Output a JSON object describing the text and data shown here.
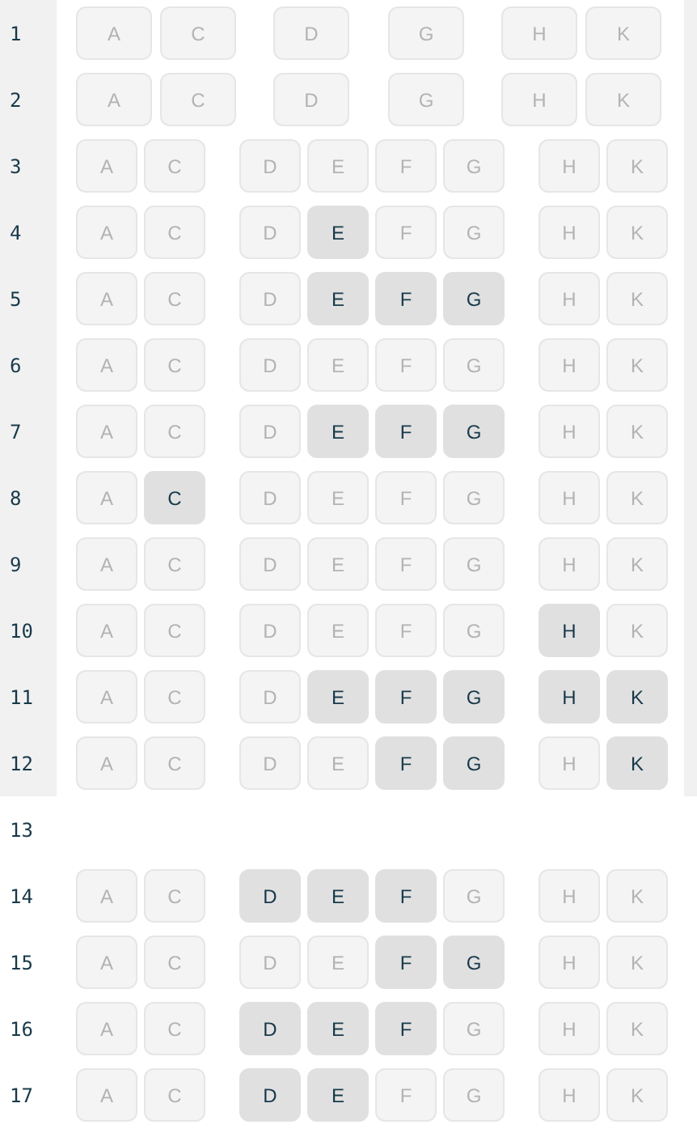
{
  "sections": [
    {
      "kind": "framed",
      "rows": [
        {
          "number": "1",
          "kind": "business",
          "blocks": [
            {
              "seats": [
                {
                  "letter": "A",
                  "available": false
                },
                {
                  "letter": "C",
                  "available": false
                }
              ]
            },
            {
              "seats": [
                {
                  "letter": "D",
                  "available": false
                },
                {
                  "letter": "G",
                  "available": false
                }
              ]
            },
            {
              "seats": [
                {
                  "letter": "H",
                  "available": false
                },
                {
                  "letter": "K",
                  "available": false
                }
              ]
            }
          ]
        },
        {
          "number": "2",
          "kind": "business",
          "blocks": [
            {
              "seats": [
                {
                  "letter": "A",
                  "available": false
                },
                {
                  "letter": "C",
                  "available": false
                }
              ]
            },
            {
              "seats": [
                {
                  "letter": "D",
                  "available": false
                },
                {
                  "letter": "G",
                  "available": false
                }
              ]
            },
            {
              "seats": [
                {
                  "letter": "H",
                  "available": false
                },
                {
                  "letter": "K",
                  "available": false
                }
              ]
            }
          ]
        },
        {
          "number": "3",
          "kind": "economy",
          "blocks": [
            {
              "seats": [
                {
                  "letter": "A",
                  "available": false
                },
                {
                  "letter": "C",
                  "available": false
                }
              ]
            },
            {
              "seats": [
                {
                  "letter": "D",
                  "available": false
                },
                {
                  "letter": "E",
                  "available": false
                },
                {
                  "letter": "F",
                  "available": false
                },
                {
                  "letter": "G",
                  "available": false
                }
              ]
            },
            {
              "seats": [
                {
                  "letter": "H",
                  "available": false
                },
                {
                  "letter": "K",
                  "available": false
                }
              ]
            }
          ]
        },
        {
          "number": "4",
          "kind": "economy",
          "blocks": [
            {
              "seats": [
                {
                  "letter": "A",
                  "available": false
                },
                {
                  "letter": "C",
                  "available": false
                }
              ]
            },
            {
              "seats": [
                {
                  "letter": "D",
                  "available": false
                },
                {
                  "letter": "E",
                  "available": true
                },
                {
                  "letter": "F",
                  "available": false
                },
                {
                  "letter": "G",
                  "available": false
                }
              ]
            },
            {
              "seats": [
                {
                  "letter": "H",
                  "available": false
                },
                {
                  "letter": "K",
                  "available": false
                }
              ]
            }
          ]
        },
        {
          "number": "5",
          "kind": "economy",
          "blocks": [
            {
              "seats": [
                {
                  "letter": "A",
                  "available": false
                },
                {
                  "letter": "C",
                  "available": false
                }
              ]
            },
            {
              "seats": [
                {
                  "letter": "D",
                  "available": false
                },
                {
                  "letter": "E",
                  "available": true
                },
                {
                  "letter": "F",
                  "available": true
                },
                {
                  "letter": "G",
                  "available": true
                }
              ]
            },
            {
              "seats": [
                {
                  "letter": "H",
                  "available": false
                },
                {
                  "letter": "K",
                  "available": false
                }
              ]
            }
          ]
        },
        {
          "number": "6",
          "kind": "economy",
          "blocks": [
            {
              "seats": [
                {
                  "letter": "A",
                  "available": false
                },
                {
                  "letter": "C",
                  "available": false
                }
              ]
            },
            {
              "seats": [
                {
                  "letter": "D",
                  "available": false
                },
                {
                  "letter": "E",
                  "available": false
                },
                {
                  "letter": "F",
                  "available": false
                },
                {
                  "letter": "G",
                  "available": false
                }
              ]
            },
            {
              "seats": [
                {
                  "letter": "H",
                  "available": false
                },
                {
                  "letter": "K",
                  "available": false
                }
              ]
            }
          ]
        },
        {
          "number": "7",
          "kind": "economy",
          "blocks": [
            {
              "seats": [
                {
                  "letter": "A",
                  "available": false
                },
                {
                  "letter": "C",
                  "available": false
                }
              ]
            },
            {
              "seats": [
                {
                  "letter": "D",
                  "available": false
                },
                {
                  "letter": "E",
                  "available": true
                },
                {
                  "letter": "F",
                  "available": true
                },
                {
                  "letter": "G",
                  "available": true
                }
              ]
            },
            {
              "seats": [
                {
                  "letter": "H",
                  "available": false
                },
                {
                  "letter": "K",
                  "available": false
                }
              ]
            }
          ]
        },
        {
          "number": "8",
          "kind": "economy",
          "blocks": [
            {
              "seats": [
                {
                  "letter": "A",
                  "available": false
                },
                {
                  "letter": "C",
                  "available": true
                }
              ]
            },
            {
              "seats": [
                {
                  "letter": "D",
                  "available": false
                },
                {
                  "letter": "E",
                  "available": false
                },
                {
                  "letter": "F",
                  "available": false
                },
                {
                  "letter": "G",
                  "available": false
                }
              ]
            },
            {
              "seats": [
                {
                  "letter": "H",
                  "available": false
                },
                {
                  "letter": "K",
                  "available": false
                }
              ]
            }
          ]
        },
        {
          "number": "9",
          "kind": "economy",
          "blocks": [
            {
              "seats": [
                {
                  "letter": "A",
                  "available": false
                },
                {
                  "letter": "C",
                  "available": false
                }
              ]
            },
            {
              "seats": [
                {
                  "letter": "D",
                  "available": false
                },
                {
                  "letter": "E",
                  "available": false
                },
                {
                  "letter": "F",
                  "available": false
                },
                {
                  "letter": "G",
                  "available": false
                }
              ]
            },
            {
              "seats": [
                {
                  "letter": "H",
                  "available": false
                },
                {
                  "letter": "K",
                  "available": false
                }
              ]
            }
          ]
        },
        {
          "number": "10",
          "kind": "economy",
          "blocks": [
            {
              "seats": [
                {
                  "letter": "A",
                  "available": false
                },
                {
                  "letter": "C",
                  "available": false
                }
              ]
            },
            {
              "seats": [
                {
                  "letter": "D",
                  "available": false
                },
                {
                  "letter": "E",
                  "available": false
                },
                {
                  "letter": "F",
                  "available": false
                },
                {
                  "letter": "G",
                  "available": false
                }
              ]
            },
            {
              "seats": [
                {
                  "letter": "H",
                  "available": true
                },
                {
                  "letter": "K",
                  "available": false
                }
              ]
            }
          ]
        },
        {
          "number": "11",
          "kind": "economy",
          "blocks": [
            {
              "seats": [
                {
                  "letter": "A",
                  "available": false
                },
                {
                  "letter": "C",
                  "available": false
                }
              ]
            },
            {
              "seats": [
                {
                  "letter": "D",
                  "available": false
                },
                {
                  "letter": "E",
                  "available": true
                },
                {
                  "letter": "F",
                  "available": true
                },
                {
                  "letter": "G",
                  "available": true
                }
              ]
            },
            {
              "seats": [
                {
                  "letter": "H",
                  "available": true
                },
                {
                  "letter": "K",
                  "available": true
                }
              ]
            }
          ]
        },
        {
          "number": "12",
          "kind": "economy",
          "blocks": [
            {
              "seats": [
                {
                  "letter": "A",
                  "available": false
                },
                {
                  "letter": "C",
                  "available": false
                }
              ]
            },
            {
              "seats": [
                {
                  "letter": "D",
                  "available": false
                },
                {
                  "letter": "E",
                  "available": false
                },
                {
                  "letter": "F",
                  "available": true
                },
                {
                  "letter": "G",
                  "available": true
                }
              ]
            },
            {
              "seats": [
                {
                  "letter": "H",
                  "available": false
                },
                {
                  "letter": "K",
                  "available": true
                }
              ]
            }
          ]
        }
      ]
    },
    {
      "kind": "open",
      "rows": [
        {
          "number": "13",
          "kind": "gap"
        },
        {
          "number": "14",
          "kind": "economy",
          "blocks": [
            {
              "seats": [
                {
                  "letter": "A",
                  "available": false
                },
                {
                  "letter": "C",
                  "available": false
                }
              ]
            },
            {
              "seats": [
                {
                  "letter": "D",
                  "available": true
                },
                {
                  "letter": "E",
                  "available": true
                },
                {
                  "letter": "F",
                  "available": true
                },
                {
                  "letter": "G",
                  "available": false
                }
              ]
            },
            {
              "seats": [
                {
                  "letter": "H",
                  "available": false
                },
                {
                  "letter": "K",
                  "available": false
                }
              ]
            }
          ]
        },
        {
          "number": "15",
          "kind": "economy",
          "blocks": [
            {
              "seats": [
                {
                  "letter": "A",
                  "available": false
                },
                {
                  "letter": "C",
                  "available": false
                }
              ]
            },
            {
              "seats": [
                {
                  "letter": "D",
                  "available": false
                },
                {
                  "letter": "E",
                  "available": false
                },
                {
                  "letter": "F",
                  "available": true
                },
                {
                  "letter": "G",
                  "available": true
                }
              ]
            },
            {
              "seats": [
                {
                  "letter": "H",
                  "available": false
                },
                {
                  "letter": "K",
                  "available": false
                }
              ]
            }
          ]
        },
        {
          "number": "16",
          "kind": "economy",
          "blocks": [
            {
              "seats": [
                {
                  "letter": "A",
                  "available": false
                },
                {
                  "letter": "C",
                  "available": false
                }
              ]
            },
            {
              "seats": [
                {
                  "letter": "D",
                  "available": true
                },
                {
                  "letter": "E",
                  "available": true
                },
                {
                  "letter": "F",
                  "available": true
                },
                {
                  "letter": "G",
                  "available": false
                }
              ]
            },
            {
              "seats": [
                {
                  "letter": "H",
                  "available": false
                },
                {
                  "letter": "K",
                  "available": false
                }
              ]
            }
          ]
        },
        {
          "number": "17",
          "kind": "economy",
          "blocks": [
            {
              "seats": [
                {
                  "letter": "A",
                  "available": false
                },
                {
                  "letter": "C",
                  "available": false
                }
              ]
            },
            {
              "seats": [
                {
                  "letter": "D",
                  "available": true
                },
                {
                  "letter": "E",
                  "available": true
                },
                {
                  "letter": "F",
                  "available": false
                },
                {
                  "letter": "G",
                  "available": false
                }
              ]
            },
            {
              "seats": [
                {
                  "letter": "H",
                  "available": false
                },
                {
                  "letter": "K",
                  "available": false
                }
              ]
            }
          ]
        }
      ]
    }
  ]
}
